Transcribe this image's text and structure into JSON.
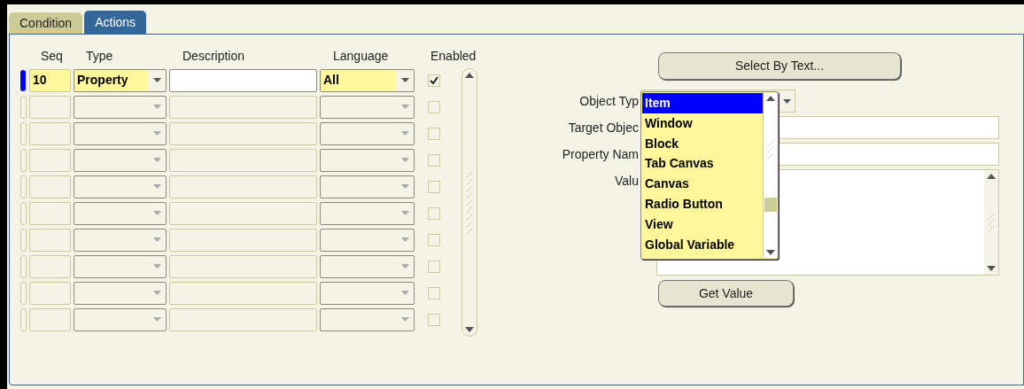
{
  "tabs": [
    {
      "label": "Condition",
      "selected": false
    },
    {
      "label": "Actions",
      "selected": true
    }
  ],
  "table": {
    "columns": [
      "Seq",
      "Type",
      "Description",
      "Language",
      "Enabled"
    ],
    "rows": [
      {
        "seq": "10",
        "type": "Property",
        "description": "",
        "language": "All",
        "enabled": true,
        "current": true
      },
      {
        "enabled": false,
        "current": false
      },
      {
        "enabled": false,
        "current": false
      },
      {
        "enabled": false,
        "current": false
      },
      {
        "enabled": false,
        "current": false
      },
      {
        "enabled": false,
        "current": false
      },
      {
        "enabled": false,
        "current": false
      },
      {
        "enabled": false,
        "current": false
      },
      {
        "enabled": false,
        "current": false
      },
      {
        "enabled": false,
        "current": false
      }
    ]
  },
  "select_by_text_button": "Select By Text...",
  "form": {
    "object_type_label": "Object Typ",
    "target_object_label": "Target Objec",
    "property_name_label": "Property Nam",
    "value_label": "Valu"
  },
  "object_type_dropdown": [
    {
      "label": "Item",
      "selected": true
    },
    {
      "label": "Window",
      "selected": false
    },
    {
      "label": "Block",
      "selected": false
    },
    {
      "label": "Tab Canvas",
      "selected": false
    },
    {
      "label": "Canvas",
      "selected": false
    },
    {
      "label": "Radio Button",
      "selected": false
    },
    {
      "label": "View",
      "selected": false
    },
    {
      "label": "Global Variable",
      "selected": false
    }
  ],
  "get_value_button": "Get Value"
}
